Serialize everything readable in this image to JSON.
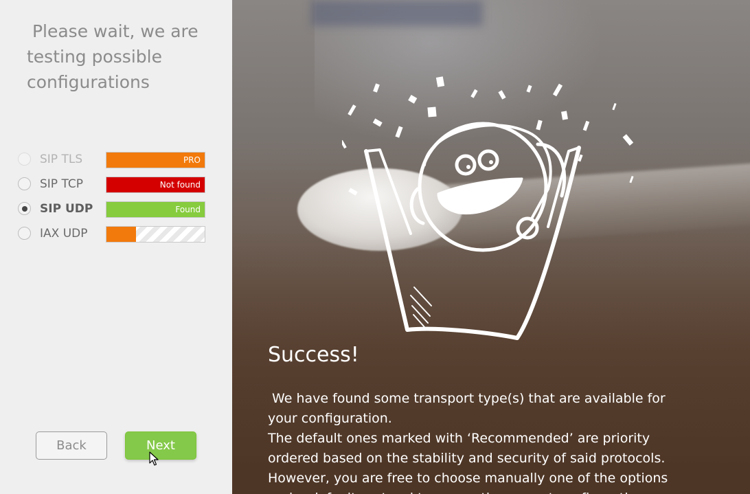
{
  "left_panel": {
    "title": " Please wait, we are testing possible configurations",
    "protocols": [
      {
        "label": "SIP TLS",
        "status": "PRO",
        "status_color": "#f27a0c",
        "progress": 1.0,
        "selected": false,
        "faded": true
      },
      {
        "label": "SIP TCP",
        "status": "Not found",
        "status_color": "#d40000",
        "progress": 1.0,
        "selected": false,
        "faded": false
      },
      {
        "label": "SIP UDP",
        "status": "Found",
        "status_color": "#86cc3e",
        "progress": 1.0,
        "selected": true,
        "faded": false
      },
      {
        "label": "IAX UDP",
        "status": "",
        "status_color": "#f27a0c",
        "progress": 0.3,
        "selected": false,
        "faded": false
      }
    ],
    "back_label": "Back",
    "next_label": "Next"
  },
  "right_panel": {
    "title": "Success!",
    "paragraphs": [
      " We have found some transport type(s) that are available for your configuration.",
      "The default ones marked with ‘Recommended’ are priority ordered based on the stability and security of said protocols. However, you are free to choose manually one of the options under default protocol to use as the current configuration."
    ]
  },
  "colors": {
    "accent_green": "#85c94a",
    "orange": "#f27a0c",
    "red": "#d40000"
  },
  "icons": [
    "radio-icon",
    "cursor-icon",
    "mascot-illustration"
  ]
}
